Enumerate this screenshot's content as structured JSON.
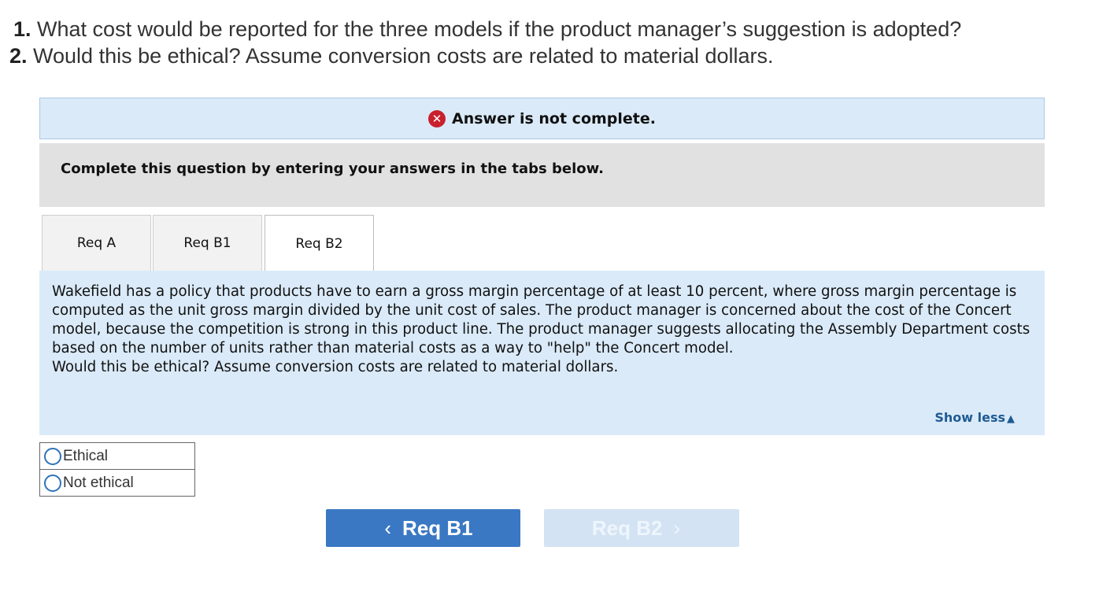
{
  "questions": [
    {
      "num": "1.",
      "text": " What cost would be reported for the three models if the product manager’s suggestion is adopted?"
    },
    {
      "num": "2.",
      "text": " Would this be ethical? Assume conversion costs are related to material dollars."
    }
  ],
  "status_banner": {
    "icon": "error-x-icon",
    "text": "Answer is not complete.",
    "color": "#c8202d"
  },
  "instructions": "Complete this question by entering your answers in the tabs below.",
  "tabs": [
    {
      "label": "Req A",
      "active": false
    },
    {
      "label": "Req B1",
      "active": false
    },
    {
      "label": "Req B2",
      "active": true
    }
  ],
  "panel": {
    "paragraph": "Wakefield has a policy that products have to earn a gross margin percentage of at least 10 percent, where gross margin percentage is computed as the unit gross margin divided by the unit cost of sales. The product manager is concerned about the cost of the Concert model, because the competition is strong in this product line. The product manager suggests allocating the Assembly Department costs based on the number of units rather than material costs as a way to \"help\" the Concert model.",
    "question": "Would this be ethical? Assume conversion costs are related to material dollars.",
    "show_less": "Show less"
  },
  "options": [
    "Ethical",
    "Not ethical"
  ],
  "navigation": {
    "prev_label": "Req B1",
    "next_label": "Req B2",
    "accent": "#3a78c3"
  }
}
